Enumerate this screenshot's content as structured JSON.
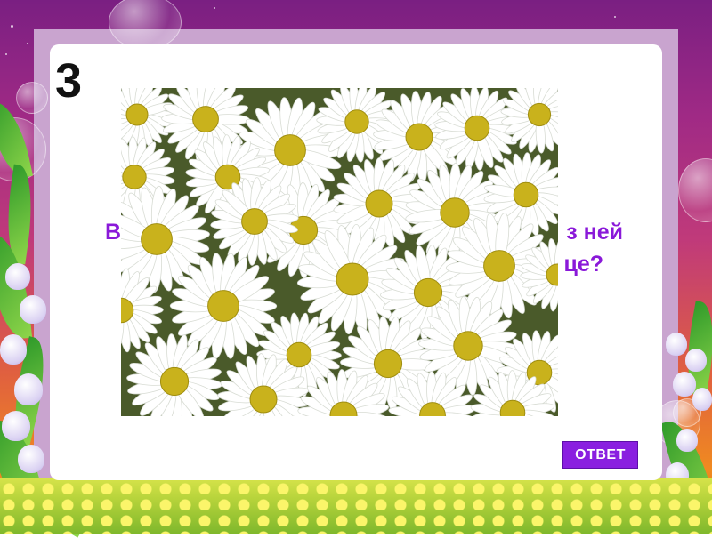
{
  "slide": {
    "question_number": "3",
    "question_fragments": {
      "left_line1": "В",
      "right_line1": "з ней",
      "right_line2": "це?"
    },
    "answer_button_label": "ОТВЕТ",
    "image_icon": "daisies-photo"
  },
  "colors": {
    "question_text": "#8a19d9",
    "answer_button": "#8a1fe0",
    "card_background": "#ffffff",
    "daisy_petal": "#ffffff",
    "daisy_center": "#c9b21c"
  }
}
